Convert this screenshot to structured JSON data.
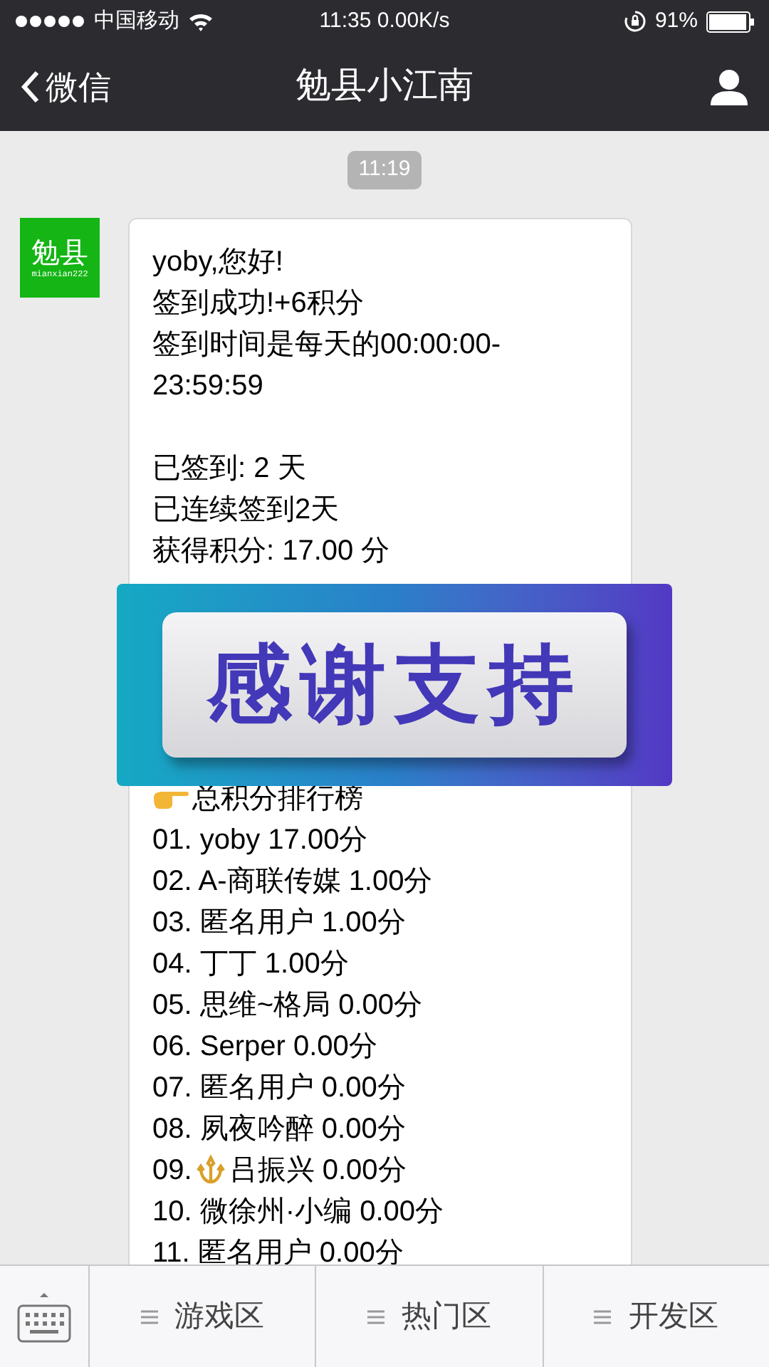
{
  "status_bar": {
    "carrier": "中国移动",
    "time": "11:35 0.00K/s",
    "battery": "91%"
  },
  "nav": {
    "back": "微信",
    "title": "勉县小江南"
  },
  "chat": {
    "timestamp": "11:19",
    "avatar": {
      "title": "勉县",
      "subtitle": "mianxian222"
    },
    "lines": [
      {
        "text": "yoby,您好!"
      },
      {
        "text": "签到成功!+6积分"
      },
      {
        "text": "签到时间是每天的00:00:00-23:59:59"
      },
      {
        "kind": "blank"
      },
      {
        "text": "已签到: 2 天"
      },
      {
        "text": "已连续签到2天"
      },
      {
        "text": "获得积分: 17.00 分"
      },
      {
        "kind": "covered"
      },
      {
        "kind": "pointer",
        "text": "总积分排行榜"
      },
      {
        "text": "01. yoby 17.00分"
      },
      {
        "text": "02. A-商联传媒 1.00分"
      },
      {
        "text": "03. 匿名用户 1.00分"
      },
      {
        "text": "04. 丁丁 1.00分"
      },
      {
        "text": "05. 思维~格局 0.00分"
      },
      {
        "text": "06. Serper 0.00分"
      },
      {
        "text": "07. 匿名用户 0.00分"
      },
      {
        "text": "08. 夙夜吟醉 0.00分"
      },
      {
        "kind": "emblem",
        "prefix": "09.",
        "text": "吕振兴 0.00分"
      },
      {
        "text": "10. 微徐州·小编 0.00分"
      },
      {
        "text": "11. 匿名用户 0.00分"
      }
    ],
    "banner": {
      "text": "感谢支持"
    }
  },
  "menu": {
    "items": [
      "游戏区",
      "热门区",
      "开发区"
    ]
  }
}
